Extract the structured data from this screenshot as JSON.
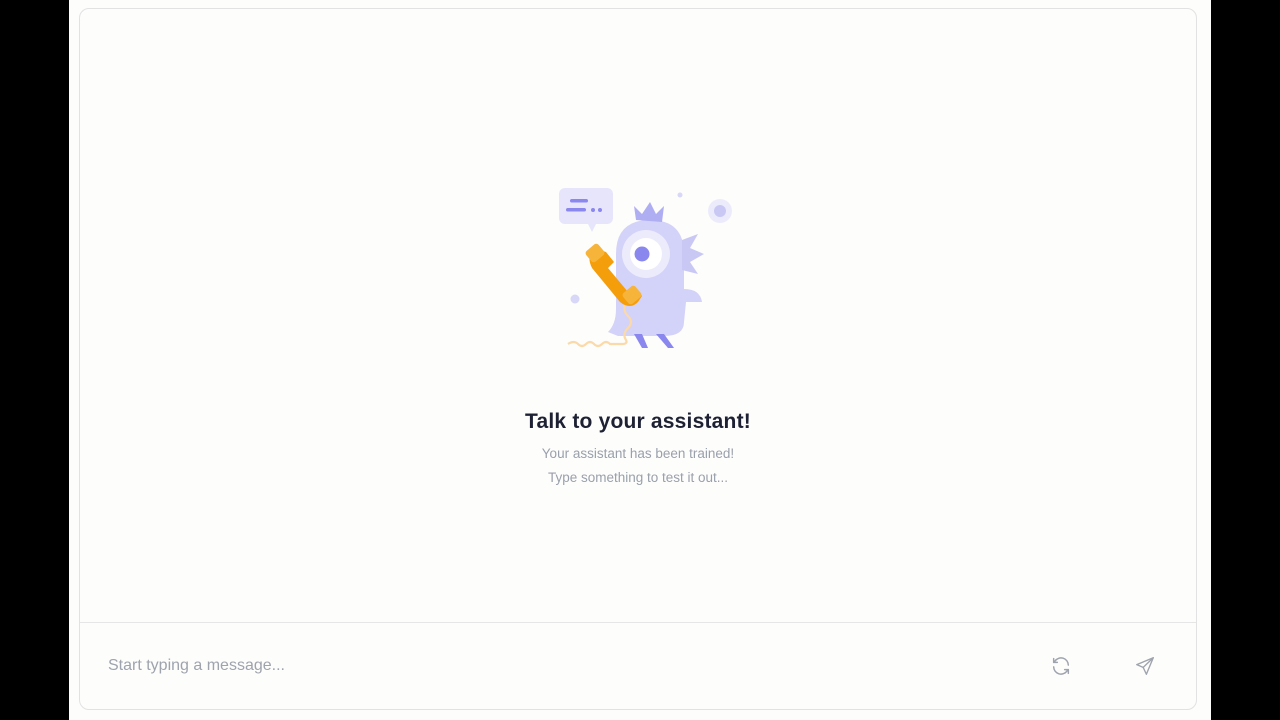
{
  "empty_state": {
    "title": "Talk to your assistant!",
    "subtitle_line1": "Your assistant has been trained!",
    "subtitle_line2": "Type something to test it out..."
  },
  "composer": {
    "placeholder": "Start typing a message..."
  },
  "icons": {
    "illustration": "assistant-mascot-phone",
    "refresh": "refresh-icon",
    "send": "send-icon",
    "cursor": "mouse-pointer-icon"
  },
  "colors": {
    "mascot": "#c9c8f5",
    "mascot_accent": "#8a87ef",
    "phone": "#f59e0b",
    "title": "#1d2133",
    "subtitle": "#9aa0ab"
  }
}
